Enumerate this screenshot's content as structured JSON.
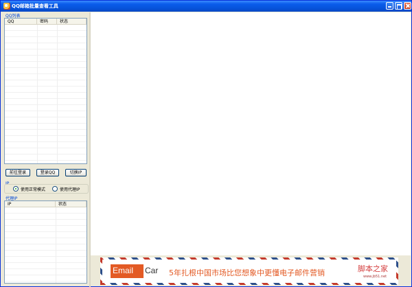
{
  "window": {
    "title": "QQ邮箱批量查看工具"
  },
  "qq_list": {
    "group_label": "QQ列表",
    "columns": [
      "QQ",
      "密码",
      "状态"
    ],
    "rows": []
  },
  "buttons": {
    "go_login": "前往登录",
    "login_qq": "登录QQ",
    "switch_ip": "切换IP"
  },
  "ip_mode": {
    "group_label": "IP",
    "options": [
      "使用正常模式",
      "使用代理IP"
    ],
    "selected": "使用正常模式"
  },
  "proxy_ip": {
    "group_label": "代理IP",
    "columns": [
      "IP",
      "状态"
    ],
    "rows": []
  },
  "banner": {
    "logo_email": "Email",
    "logo_car": "Car",
    "slogan": "5年扎根中国市场比您想象中更懂电子邮件营销"
  },
  "watermark": {
    "text": "脚本之家",
    "sub": "www.jb51.net"
  },
  "colors": {
    "titlebar": "#0A5CEB",
    "group_label": "#0046D5",
    "brand_orange": "#E35A24",
    "background": "#ECE9D8"
  }
}
